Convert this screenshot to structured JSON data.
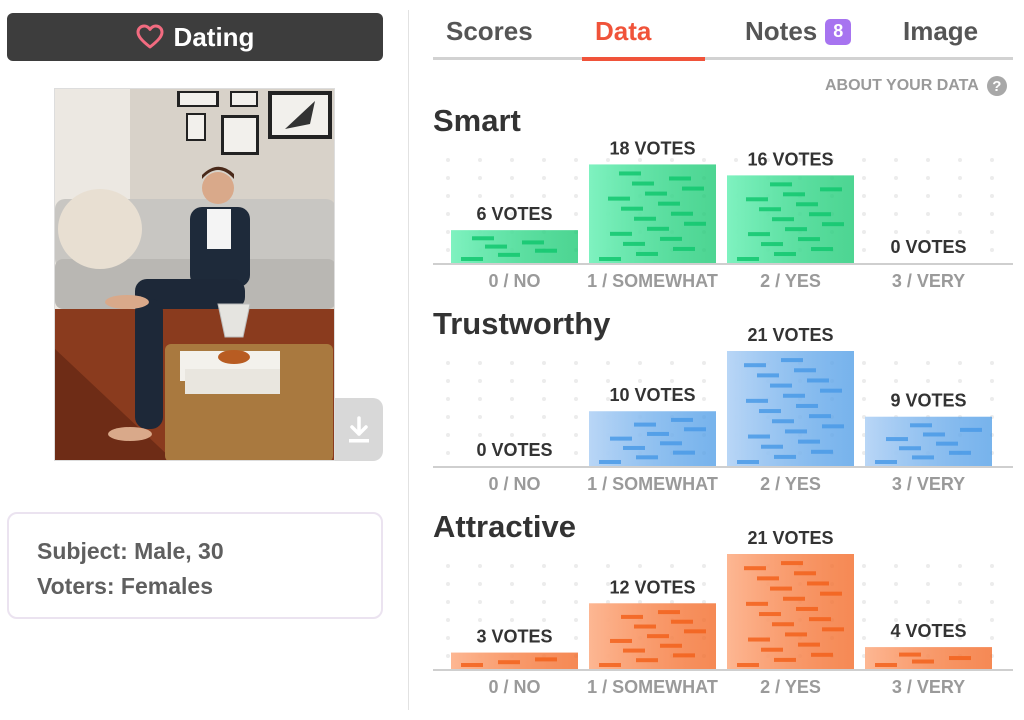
{
  "category": {
    "label": "Dating",
    "icon": "heart-outline-icon"
  },
  "photo": {
    "description_icon": "subject-photo"
  },
  "subject": {
    "line1": "Subject: Male, 30",
    "line2": "Voters: Females"
  },
  "tabs": [
    {
      "label": "Scores",
      "active": false
    },
    {
      "label": "Data",
      "active": true
    },
    {
      "label": "Notes",
      "active": false,
      "badge": "8"
    },
    {
      "label": "Image",
      "active": false
    }
  ],
  "about": {
    "label": "ABOUT YOUR DATA",
    "icon": "help-icon",
    "icon_glyph": "?"
  },
  "colors": {
    "accent": "#f0533a",
    "badge": "#a774f0",
    "smart": "#3ee39b",
    "trustworthy": "#8fbdf0",
    "attractive": "#f98a4e"
  },
  "chart_data": [
    {
      "type": "bar",
      "title": "Smart",
      "categories": [
        "0 / NO",
        "1 / SOMEWHAT",
        "2 / YES",
        "3 / VERY"
      ],
      "values": [
        6,
        18,
        16,
        0
      ],
      "labels": [
        "6 VOTES",
        "18 VOTES",
        "16 VOTES",
        "0 VOTES"
      ],
      "color_light": "#7ff2c0",
      "color_dark": "#12c76e",
      "grid": true
    },
    {
      "type": "bar",
      "title": "Trustworthy",
      "categories": [
        "0 / NO",
        "1 / SOMEWHAT",
        "2 / YES",
        "3 / VERY"
      ],
      "values": [
        0,
        10,
        21,
        9
      ],
      "labels": [
        "0 VOTES",
        "10 VOTES",
        "21 VOTES",
        "9 VOTES"
      ],
      "color_light": "#b9d6f6",
      "color_dark": "#4a9ae6",
      "grid": true
    },
    {
      "type": "bar",
      "title": "Attractive",
      "categories": [
        "0 / NO",
        "1 / SOMEWHAT",
        "2 / YES",
        "3 / VERY"
      ],
      "values": [
        3,
        12,
        21,
        4
      ],
      "labels": [
        "3 VOTES",
        "12 VOTES",
        "21 VOTES",
        "4 VOTES"
      ],
      "color_light": "#fdb793",
      "color_dark": "#f2621c",
      "grid": true
    }
  ]
}
